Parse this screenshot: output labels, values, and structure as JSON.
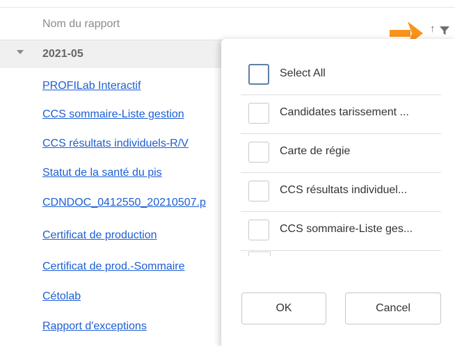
{
  "header": {
    "column_label": "Nom du rapport",
    "sort_icon": "sort-ascending-icon",
    "filter_icon": "filter-icon",
    "annotation_arrow_color": "#f7941d"
  },
  "group": {
    "label": "2021-05",
    "expanded": true
  },
  "reports": [
    "PROFILab Interactif",
    "CCS sommaire-Liste gestion",
    "CCS résultats individuels-R/V",
    "Statut de la santé du pis",
    "CDNDOC_0412550_20210507.p",
    "Certificat de production",
    "Certificat de prod.-Sommaire",
    "Cétolab",
    "Rapport d'exceptions"
  ],
  "filter_panel": {
    "options": [
      {
        "label": "Select All",
        "checked": false
      },
      {
        "label": "Candidates tarissement ...",
        "checked": false
      },
      {
        "label": "Carte de régie",
        "checked": false
      },
      {
        "label": "CCS résultats individuel...",
        "checked": false
      },
      {
        "label": "CCS sommaire-Liste ges...",
        "checked": false
      }
    ],
    "ok_label": "OK",
    "cancel_label": "Cancel"
  },
  "colors": {
    "link": "#1d5fd4",
    "group_background": "#f0f0f0",
    "accent_arrow": "#f7941d"
  }
}
